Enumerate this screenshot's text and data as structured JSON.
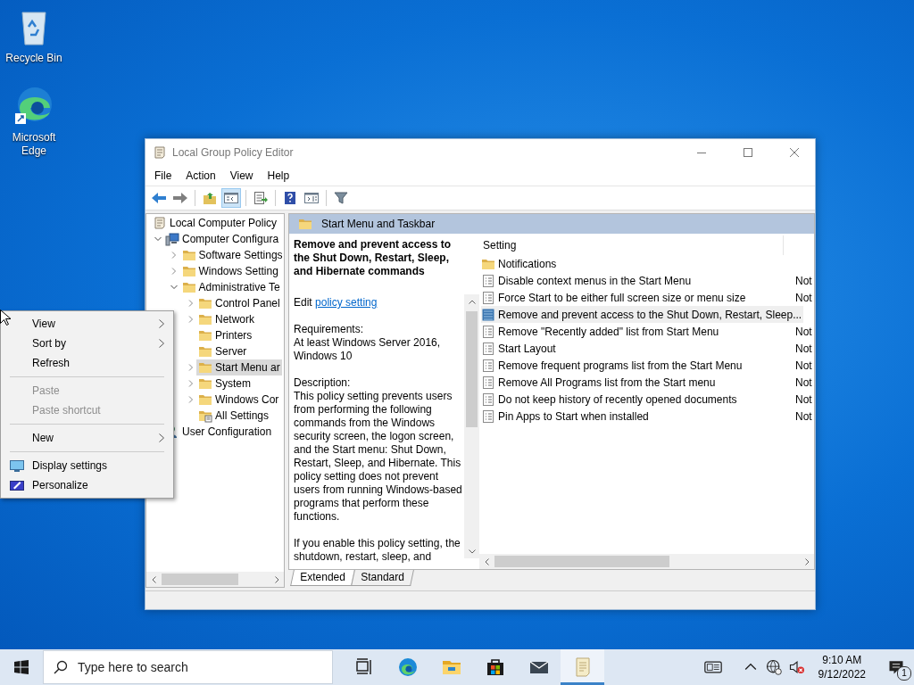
{
  "desktop_icons": [
    {
      "kind": "recycle",
      "label": "Recycle Bin"
    },
    {
      "kind": "edge",
      "label": "Microsoft Edge"
    }
  ],
  "window": {
    "title": "Local Group Policy Editor",
    "menu": [
      "File",
      "Action",
      "View",
      "Help"
    ],
    "toolbar": [
      {
        "kind": "back",
        "disabled": false,
        "pressed": false
      },
      {
        "kind": "forward",
        "disabled": true,
        "pressed": false
      },
      {
        "kind": "separator"
      },
      {
        "kind": "up",
        "disabled": false,
        "pressed": false
      },
      {
        "kind": "tree",
        "disabled": false,
        "pressed": true
      },
      {
        "kind": "separator"
      },
      {
        "kind": "export",
        "disabled": false,
        "pressed": false
      },
      {
        "kind": "separator"
      },
      {
        "kind": "help",
        "disabled": false,
        "pressed": false
      },
      {
        "kind": "pane",
        "disabled": false,
        "pressed": false
      },
      {
        "kind": "separator"
      },
      {
        "kind": "filter",
        "disabled": false,
        "pressed": false
      }
    ],
    "tree": [
      {
        "label": "Local Computer Policy",
        "kind": "policy",
        "selected": false,
        "children": [
          {
            "label": "Computer Configura",
            "kind": "computer",
            "selected": false,
            "expanded": true,
            "children": [
              {
                "label": "Software Settings",
                "kind": "folder",
                "selected": false,
                "expanded": false
              },
              {
                "label": "Windows Setting",
                "kind": "folder",
                "selected": false,
                "expanded": false
              },
              {
                "label": "Administrative Te",
                "kind": "folder",
                "selected": false,
                "expanded": true,
                "children": [
                  {
                    "label": "Control Panel",
                    "kind": "folder",
                    "selected": false,
                    "expanded": false
                  },
                  {
                    "label": "Network",
                    "kind": "folder",
                    "selected": false,
                    "expanded": false
                  },
                  {
                    "label": "Printers",
                    "kind": "folder",
                    "selected": false
                  },
                  {
                    "label": "Server",
                    "kind": "folder",
                    "selected": false
                  },
                  {
                    "label": "Start Menu ar",
                    "kind": "folder",
                    "selected": true,
                    "expanded": false
                  },
                  {
                    "label": "System",
                    "kind": "folder",
                    "selected": false,
                    "expanded": false
                  },
                  {
                    "label": "Windows Cor",
                    "kind": "folder",
                    "selected": false,
                    "expanded": false
                  },
                  {
                    "label": "All Settings",
                    "kind": "settings",
                    "selected": false
                  }
                ]
              }
            ]
          },
          {
            "label": "User Configuration",
            "kind": "user",
            "selected": false
          }
        ]
      }
    ],
    "pane_header": "Start Menu and Taskbar",
    "details": {
      "title": "Remove and prevent access to the Shut Down, Restart, Sleep, and Hibernate commands",
      "edit_prefix": "Edit",
      "edit_link": "policy setting",
      "requirements_label": "Requirements:",
      "requirements": "At least Windows Server 2016, Windows 10",
      "description_label": "Description:",
      "paragraphs": [
        "This policy setting prevents users from performing the following commands from the Windows security screen, the logon screen, and the Start menu: Shut Down, Restart, Sleep, and Hibernate. This policy setting does not prevent users from running Windows-based programs that perform these functions.",
        "If you enable this policy setting, the shutdown, restart, sleep, and"
      ]
    },
    "list": {
      "columns": [
        "Setting"
      ],
      "rows": [
        {
          "kind": "folder",
          "name": "Notifications",
          "selected": false
        },
        {
          "kind": "policy",
          "name": "Disable context menus in the Start Menu",
          "state": "Not",
          "selected": false
        },
        {
          "kind": "policy",
          "name": "Force Start to be either full screen size or menu size",
          "state": "Not",
          "selected": false
        },
        {
          "kind": "policy",
          "name": "Remove and prevent access to the Shut Down, Restart, Sleep...",
          "selected": true
        },
        {
          "kind": "policy",
          "name": "Remove \"Recently added\" list from Start Menu",
          "state": "Not",
          "selected": false
        },
        {
          "kind": "policy",
          "name": "Start Layout",
          "state": "Not",
          "selected": false
        },
        {
          "kind": "policy",
          "name": "Remove frequent programs list from the Start Menu",
          "state": "Not",
          "selected": false
        },
        {
          "kind": "policy",
          "name": "Remove All Programs list from the Start menu",
          "state": "Not",
          "selected": false
        },
        {
          "kind": "policy",
          "name": "Do not keep history of recently opened documents",
          "state": "Not",
          "selected": false
        },
        {
          "kind": "policy",
          "name": "Pin Apps to Start when installed",
          "state": "Not",
          "selected": false
        }
      ]
    },
    "tabs": [
      {
        "label": "Extended",
        "selected": true
      },
      {
        "label": "Standard",
        "selected": false
      }
    ]
  },
  "context_menu": [
    {
      "kind": "item",
      "label": "View",
      "submenu": true,
      "disabled": false
    },
    {
      "kind": "item",
      "label": "Sort by",
      "submenu": true,
      "disabled": false
    },
    {
      "kind": "item",
      "label": "Refresh",
      "submenu": false,
      "disabled": false
    },
    {
      "kind": "separator"
    },
    {
      "kind": "item",
      "label": "Paste",
      "submenu": false,
      "disabled": true
    },
    {
      "kind": "item",
      "label": "Paste shortcut",
      "submenu": false,
      "disabled": true
    },
    {
      "kind": "separator"
    },
    {
      "kind": "item",
      "label": "New",
      "submenu": true,
      "disabled": false
    },
    {
      "kind": "separator"
    },
    {
      "kind": "display",
      "label": "Display settings",
      "submenu": false,
      "disabled": false
    },
    {
      "kind": "personalize",
      "label": "Personalize",
      "submenu": false,
      "disabled": false
    }
  ],
  "taskbar": {
    "search": {
      "placeholder": "Type here to search"
    },
    "apps": [
      {
        "kind": "task_view",
        "active": false
      },
      {
        "kind": "edge",
        "active": false
      },
      {
        "kind": "explorer",
        "active": false
      },
      {
        "kind": "store",
        "active": false
      },
      {
        "kind": "mail",
        "active": false
      },
      {
        "kind": "notepad",
        "active": true
      }
    ],
    "time": "9:10 AM",
    "date": "9/12/2022",
    "notifications": "1"
  }
}
